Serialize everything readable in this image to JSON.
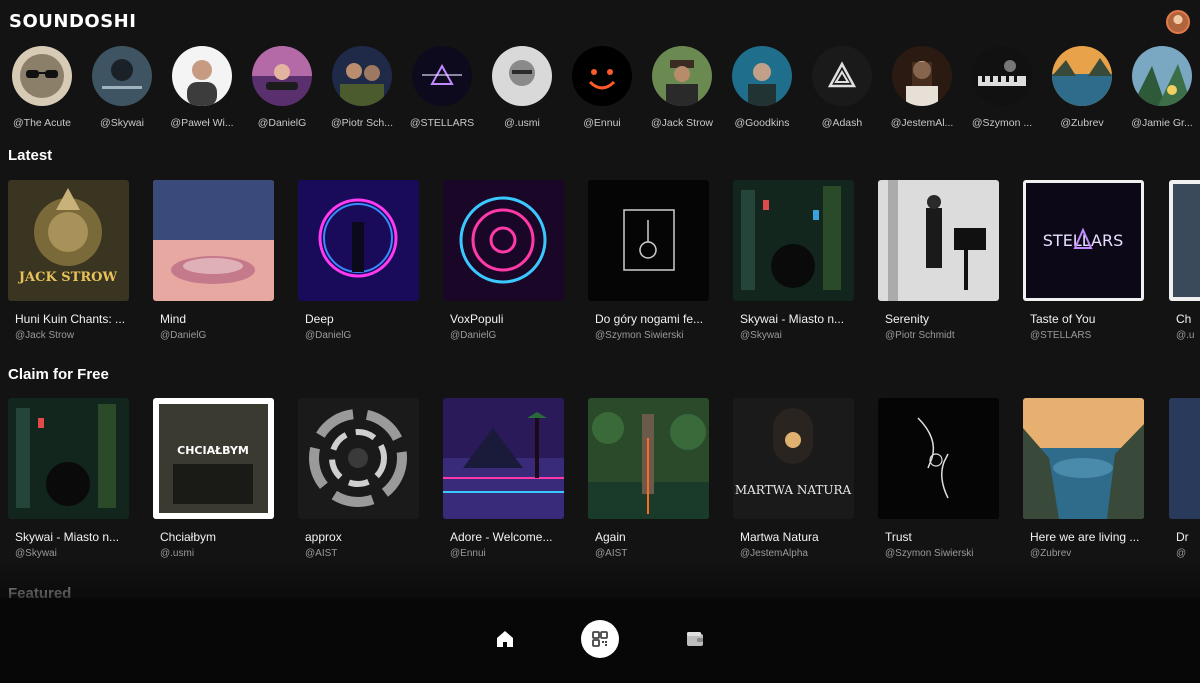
{
  "header": {
    "logo": "SOUNDOSHI"
  },
  "artists": [
    {
      "name": "@The Acute"
    },
    {
      "name": "@Skywai"
    },
    {
      "name": "@Paweł Wi..."
    },
    {
      "name": "@DanielG"
    },
    {
      "name": "@Piotr Sch..."
    },
    {
      "name": "@STELLARS"
    },
    {
      "name": "@.usmi"
    },
    {
      "name": "@Ennui"
    },
    {
      "name": "@Jack Strow"
    },
    {
      "name": "@Goodkins"
    },
    {
      "name": "@Adash"
    },
    {
      "name": "@JestemAl..."
    },
    {
      "name": "@Szymon ..."
    },
    {
      "name": "@Zubrev"
    },
    {
      "name": "@Jamie Gr..."
    }
  ],
  "sections": {
    "latest": {
      "title": "Latest",
      "items": [
        {
          "title": "Huni Kuin Chants: ...",
          "artist": "@Jack Strow",
          "art_text": "JACK STROW"
        },
        {
          "title": "Mind",
          "artist": "@DanielG"
        },
        {
          "title": "Deep",
          "artist": "@DanielG"
        },
        {
          "title": "VoxPopuli",
          "artist": "@DanielG"
        },
        {
          "title": "Do góry nogami fe...",
          "artist": "@Szymon Siwierski"
        },
        {
          "title": "Skywai - Miasto n...",
          "artist": "@Skywai"
        },
        {
          "title": "Serenity",
          "artist": "@Piotr Schmidt"
        },
        {
          "title": "Taste of You",
          "artist": "@STELLARS",
          "art_text": "STELLARS"
        },
        {
          "title": "Ch",
          "artist": "@.u"
        }
      ]
    },
    "claim": {
      "title": "Claim for Free",
      "items": [
        {
          "title": "Skywai - Miasto n...",
          "artist": "@Skywai"
        },
        {
          "title": "Chciałbym",
          "artist": "@.usmi",
          "art_text": "CHCIAŁBYM"
        },
        {
          "title": "approx",
          "artist": "@AIST"
        },
        {
          "title": "Adore - Welcome...",
          "artist": "@Ennui"
        },
        {
          "title": "Again",
          "artist": "@AIST"
        },
        {
          "title": "Martwa Natura",
          "artist": "@JestemAlpha",
          "art_text": "MARTWA NATURA"
        },
        {
          "title": "Trust",
          "artist": "@Szymon Siwierski"
        },
        {
          "title": "Here we are living ...",
          "artist": "@Zubrev"
        },
        {
          "title": "Dr",
          "artist": "@"
        }
      ]
    },
    "featured": {
      "title": "Featured"
    }
  },
  "nav": {
    "home_icon": "home-icon",
    "scan_icon": "qr-scan-icon",
    "wallet_icon": "wallet-icon"
  },
  "colors": {
    "background": "#131313",
    "nav_background": "#070707",
    "accent_avatar": "#e37a4a"
  }
}
